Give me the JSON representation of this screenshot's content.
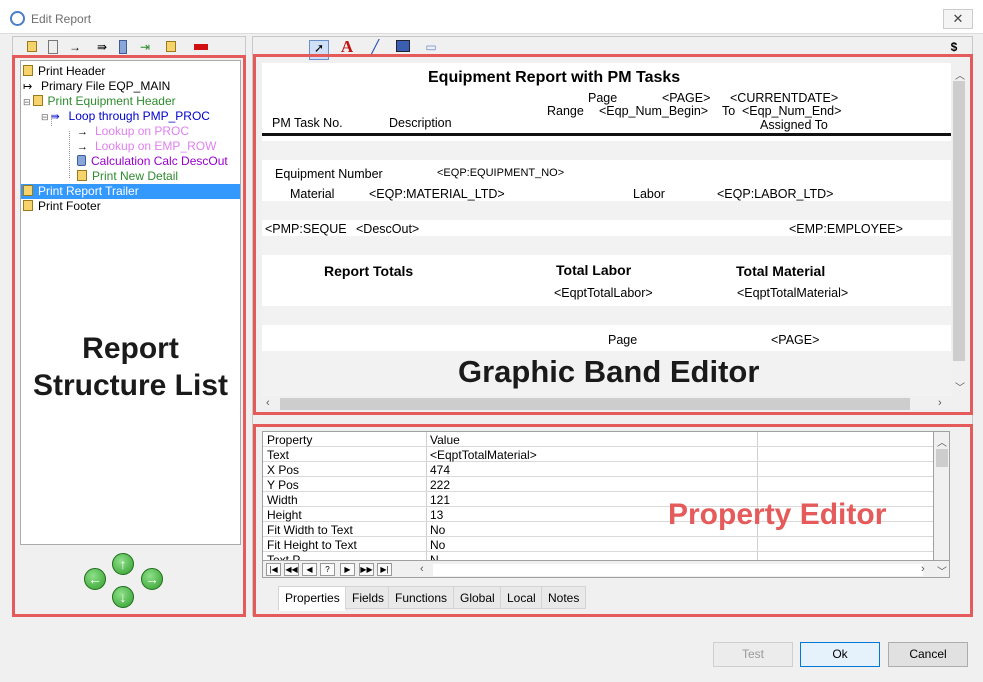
{
  "window": {
    "title": "Edit Report",
    "close_label": "✕"
  },
  "toolbar_left": {
    "icons": [
      "print-band-icon",
      "edit-band-icon",
      "arrow-icon",
      "loop-arrow-icon",
      "file-icon",
      "insert-band-icon",
      "delete-icon"
    ]
  },
  "toolbar_right": {
    "icons": [
      "pointer-icon",
      "text-tool-icon",
      "line-tool-icon",
      "box-tool-icon",
      "image-tool-icon"
    ],
    "dollar": "$"
  },
  "tree": {
    "items": [
      {
        "label": "Print Header"
      },
      {
        "label": "Primary File EQP_MAIN"
      },
      {
        "label": "Print Equipment Header"
      },
      {
        "label": "Loop through  PMP_PROC"
      },
      {
        "label": "Lookup on PROC"
      },
      {
        "label": "Lookup on EMP_ROW"
      },
      {
        "label": "Calculation Calc DescOut"
      },
      {
        "label": "Print New Detail"
      },
      {
        "label": "Print Report Trailer"
      },
      {
        "label": "Print Footer"
      }
    ]
  },
  "annotations": {
    "structure_list": "Report Structure List",
    "band_editor": "Graphic Band Editor",
    "property_editor": "Property Editor"
  },
  "report": {
    "title": "Equipment Report with PM Tasks",
    "page_label": "Page",
    "page_field": "<PAGE>",
    "current_date": "<CURRENTDATE>",
    "range_label": "Range",
    "range_begin": "<Eqp_Num_Begin>",
    "to_label": "To",
    "range_end": "<Eqp_Num_End>",
    "col_task": "PM Task No.",
    "col_desc": "Description",
    "col_assigned": "Assigned To",
    "equip_label": "Equipment Number",
    "equip_field": "<EQP:EQUIPMENT_NO>",
    "material_label": "Material",
    "material_field": "<EQP:MATERIAL_LTD>",
    "labor_label": "Labor",
    "labor_field": "<EQP:LABOR_LTD>",
    "seq_field": "<PMP:SEQUE",
    "descout_field": "<DescOut>",
    "employee_field": "<EMP:EMPLOYEE>",
    "totals_label": "Report Totals",
    "total_labor_label": "Total Labor",
    "total_material_label": "Total Material",
    "total_labor_field": "<EqptTotalLabor>",
    "total_material_field": "<EqptTotalMaterial>",
    "footer_page_label": "Page",
    "footer_page_field": "<PAGE>"
  },
  "properties": {
    "headers": [
      "Property",
      "Value"
    ],
    "rows": [
      {
        "name": "Text",
        "value": "<EqptTotalMaterial>"
      },
      {
        "name": "X Pos",
        "value": "474"
      },
      {
        "name": "Y Pos",
        "value": "222"
      },
      {
        "name": "Width",
        "value": "121"
      },
      {
        "name": "Height",
        "value": "13"
      },
      {
        "name": "Fit Width to Text",
        "value": "No"
      },
      {
        "name": "Fit Height to Text",
        "value": "No"
      },
      {
        "name": "Text P...",
        "value": "N..."
      }
    ]
  },
  "tabs": [
    "Properties",
    "Fields",
    "Functions",
    "Global",
    "Local",
    "Notes"
  ],
  "buttons": {
    "test": "Test",
    "ok": "Ok",
    "cancel": "Cancel"
  },
  "colors": {
    "annotation_red": "#e55a5a",
    "selection": "#3399ff",
    "tree_green": "#2e8b2e",
    "tree_blue": "#0000cc",
    "tree_purple": "#9900cc",
    "tree_pink": "#e080f0"
  }
}
